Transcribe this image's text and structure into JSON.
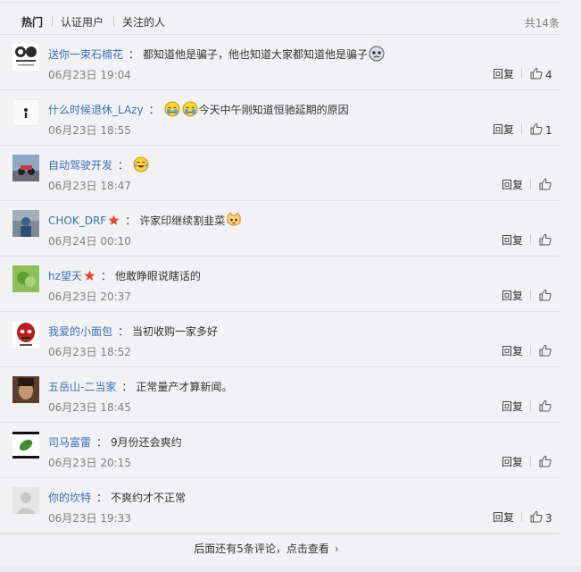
{
  "tabs": [
    {
      "label": "热门",
      "active": true
    },
    {
      "label": "认证用户",
      "active": false
    },
    {
      "label": "关注的人",
      "active": false
    }
  ],
  "total": "共14条",
  "reply_label": "回复",
  "comments": [
    {
      "user": "送你一束石楠花",
      "text": "都知道他是骗子，他也知道大家都知道他是骗子",
      "time": "06月23日 19:04",
      "likes": "4",
      "star": false
    },
    {
      "user": "什么时候退休_LAzy",
      "text": "今天中午刚知道恒驰延期的原因",
      "time": "06月23日 18:55",
      "likes": "1",
      "star": false
    },
    {
      "user": "自动驾驶开发",
      "text": "",
      "time": "06月23日 18:47",
      "likes": "",
      "star": false
    },
    {
      "user": "CHOK_DRF",
      "text": "许家印继续割韭菜",
      "time": "06月24日 00:10",
      "likes": "",
      "star": true
    },
    {
      "user": "hz望天",
      "text": "他敢睁眼说瞎话的",
      "time": "06月23日 20:37",
      "likes": "",
      "star": true
    },
    {
      "user": "我爱的小面包",
      "text": "当初收购一家多好",
      "time": "06月23日 18:52",
      "likes": "",
      "star": false
    },
    {
      "user": "五岳山-二当家",
      "text": "正常量产才算新闻。",
      "time": "06月23日 18:45",
      "likes": "",
      "star": false
    },
    {
      "user": "司马富雷",
      "text": "9月份还会爽约",
      "time": "06月23日 20:15",
      "likes": "",
      "star": false
    },
    {
      "user": "你的坎特",
      "text": "不爽约才不正常",
      "time": "06月23日 19:33",
      "likes": "3",
      "star": false
    }
  ],
  "more_text": "后面还有5条评论，点击查看",
  "colors": {
    "link": "#3b6fb6",
    "star": "#e8462a",
    "text": "#333333",
    "muted": "#808080"
  }
}
